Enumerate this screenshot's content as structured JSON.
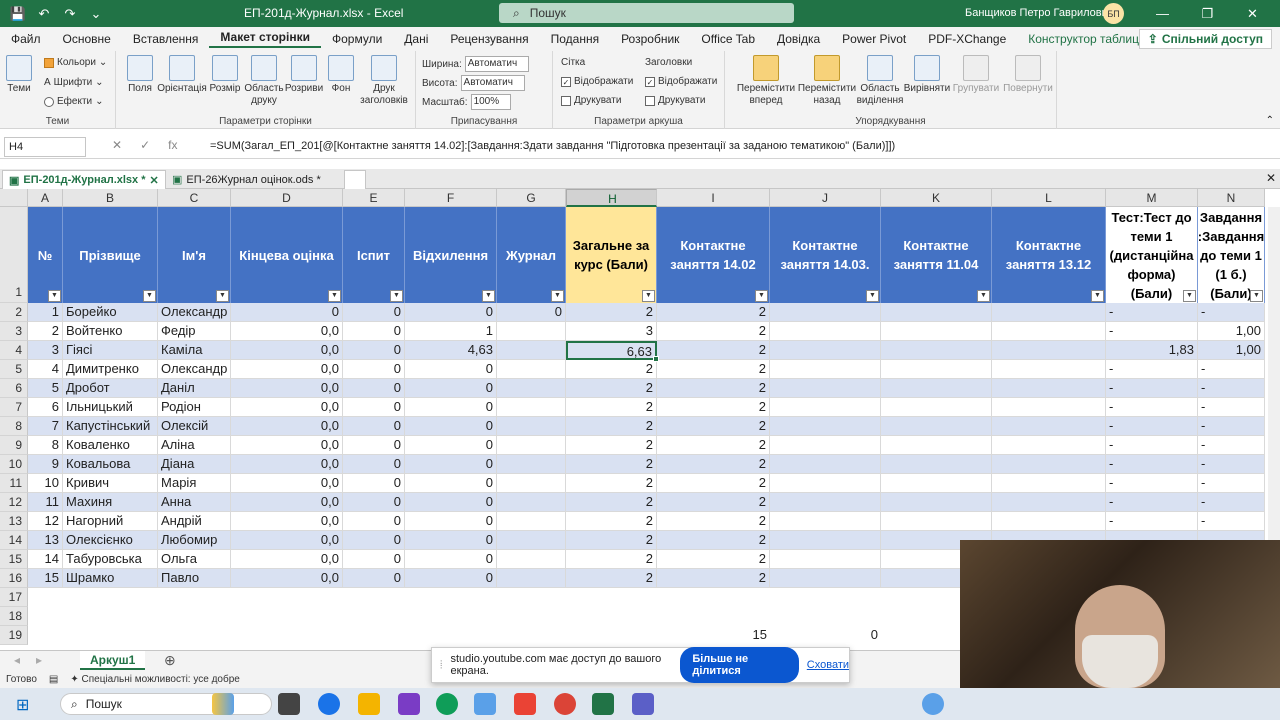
{
  "app": {
    "filename": "ЕП-201д-Журнал.xlsx",
    "separator": "-",
    "appname": "Excel",
    "search": "Пошук",
    "user": "Банщиков Петро Гаврилович",
    "initials": "БП"
  },
  "menu": [
    "Файл",
    "Основне",
    "Вставлення",
    "Макет сторінки",
    "Формули",
    "Дані",
    "Рецензування",
    "Подання",
    "Розробник",
    "Office Tab",
    "Довідка",
    "Power Pivot",
    "PDF-XChange",
    "Конструктор таблиць"
  ],
  "share": "Спільний доступ",
  "ribbon": {
    "themes": {
      "group": "Теми",
      "big": "Теми",
      "colors": "Кольори",
      "fonts": "Шрифти",
      "effects": "Ефекти"
    },
    "page_setup": {
      "group": "Параметри сторінки",
      "buttons": [
        "Поля",
        "Орієнтація",
        "Розмір",
        "Область\nдруку",
        "Розриви",
        "Фон",
        "Друк\nзаголовків"
      ]
    },
    "scale": {
      "group": "Припасування",
      "width_label": "Ширина:",
      "width_val": "Автоматич",
      "height_label": "Висота:",
      "height_val": "Автоматич",
      "scale_label": "Масштаб:",
      "scale_val": "100%"
    },
    "sheet_opts": {
      "group": "Параметри аркуша",
      "grid": "Сітка",
      "headings": "Заголовки",
      "view": "Відображати",
      "print": "Друкувати"
    },
    "arrange": {
      "group": "Упорядкування",
      "buttons": [
        "Перемістити\nвперед",
        "Перемістити\nназад",
        "Область\nвиділення",
        "Вирівняти",
        "Групувати",
        "Повернути"
      ]
    }
  },
  "formula_bar": {
    "namebox": "H4",
    "formula": "=SUM(Загал_ЕП_201[@[Контактне заняття 14.02]:[Завдання:Здати завдання \"Підготовка презентації за заданою тематикою\" (Бали)]])"
  },
  "file_tabs": [
    "ЕП-201д-Журнал.xlsx *",
    "ЕП-26Журнал оцінок.ods *"
  ],
  "columns": [
    "A",
    "B",
    "C",
    "D",
    "E",
    "F",
    "G",
    "H",
    "I",
    "J",
    "K",
    "L",
    "M",
    "N"
  ],
  "headers": [
    "№",
    "Прізвище",
    "Ім'я",
    "Кінцева оцінка",
    "Іспит",
    "Відхилення",
    "Журнал",
    "Загальне за курс (Бали)",
    "Контактне заняття 14.02",
    "Контактне заняття 14.03.",
    "Контактне заняття 11.04",
    "Контактне заняття 13.12",
    "Тест:Тест до теми 1 (дистанційна форма) (Бали)",
    "Завдання :Завдання до теми 1 (1 б.) (Бали)"
  ],
  "rows": [
    [
      "1",
      "Борейко",
      "Олександр",
      "0",
      "0",
      "0",
      "0",
      "2",
      "2",
      "",
      "",
      "",
      "-",
      "-"
    ],
    [
      "2",
      "Войтенко",
      "Федір",
      "0,0",
      "0",
      "1",
      "",
      "3",
      "2",
      "",
      "",
      "",
      "-",
      "1,00"
    ],
    [
      "3",
      "Гіясі",
      "Каміла",
      "0,0",
      "0",
      "4,63",
      "",
      "6,63",
      "2",
      "",
      "",
      "",
      "1,83",
      "1,00"
    ],
    [
      "4",
      "Димитренко",
      "Олександр",
      "0,0",
      "0",
      "0",
      "",
      "2",
      "2",
      "",
      "",
      "",
      "-",
      "-"
    ],
    [
      "5",
      "Дробот",
      "Даніл",
      "0,0",
      "0",
      "0",
      "",
      "2",
      "2",
      "",
      "",
      "",
      "-",
      "-"
    ],
    [
      "6",
      "Ільницький",
      "Родіон",
      "0,0",
      "0",
      "0",
      "",
      "2",
      "2",
      "",
      "",
      "",
      "-",
      "-"
    ],
    [
      "7",
      "Капустінський",
      "Олексій",
      "0,0",
      "0",
      "0",
      "",
      "2",
      "2",
      "",
      "",
      "",
      "-",
      "-"
    ],
    [
      "8",
      "Коваленко",
      "Аліна",
      "0,0",
      "0",
      "0",
      "",
      "2",
      "2",
      "",
      "",
      "",
      "-",
      "-"
    ],
    [
      "9",
      "Ковальова",
      "Діана",
      "0,0",
      "0",
      "0",
      "",
      "2",
      "2",
      "",
      "",
      "",
      "-",
      "-"
    ],
    [
      "10",
      "Кривич",
      "Марія",
      "0,0",
      "0",
      "0",
      "",
      "2",
      "2",
      "",
      "",
      "",
      "-",
      "-"
    ],
    [
      "11",
      "Махиня",
      "Анна",
      "0,0",
      "0",
      "0",
      "",
      "2",
      "2",
      "",
      "",
      "",
      "-",
      "-"
    ],
    [
      "12",
      "Нагорний",
      "Андрій",
      "0,0",
      "0",
      "0",
      "",
      "2",
      "2",
      "",
      "",
      "",
      "-",
      "-"
    ],
    [
      "13",
      "Олексієнко",
      "Любомир",
      "0,0",
      "0",
      "0",
      "",
      "2",
      "2",
      "",
      "",
      "",
      "",
      ""
    ],
    [
      "14",
      "Табуровська",
      "Ольга",
      "0,0",
      "0",
      "0",
      "",
      "2",
      "2",
      "",
      "",
      "",
      "",
      ""
    ],
    [
      "15",
      "Шрамко",
      "Павло",
      "0,0",
      "0",
      "0",
      "",
      "2",
      "2",
      "",
      "",
      "",
      "",
      ""
    ]
  ],
  "row_numbers": [
    "1",
    "2",
    "3",
    "4",
    "5",
    "6",
    "7",
    "8",
    "9",
    "10",
    "11",
    "12",
    "13",
    "14",
    "15",
    "16",
    "17",
    "18",
    "19"
  ],
  "row19": {
    "I": "15",
    "J": "0"
  },
  "sheet": {
    "tab": "Аркуш1"
  },
  "status": {
    "ready": "Готово",
    "access": "Спеціальні можливості: усе добре"
  },
  "notice": {
    "text": "studio.youtube.com має доступ до вашого екрана.",
    "button": "Більше не ділитися",
    "link": "Сховати"
  },
  "taskbar": {
    "search": "Пошук"
  },
  "colors": {
    "brand": "#217346",
    "header": "#4472c4",
    "band": "#d9e1f2",
    "highlight": "#ffe699"
  }
}
